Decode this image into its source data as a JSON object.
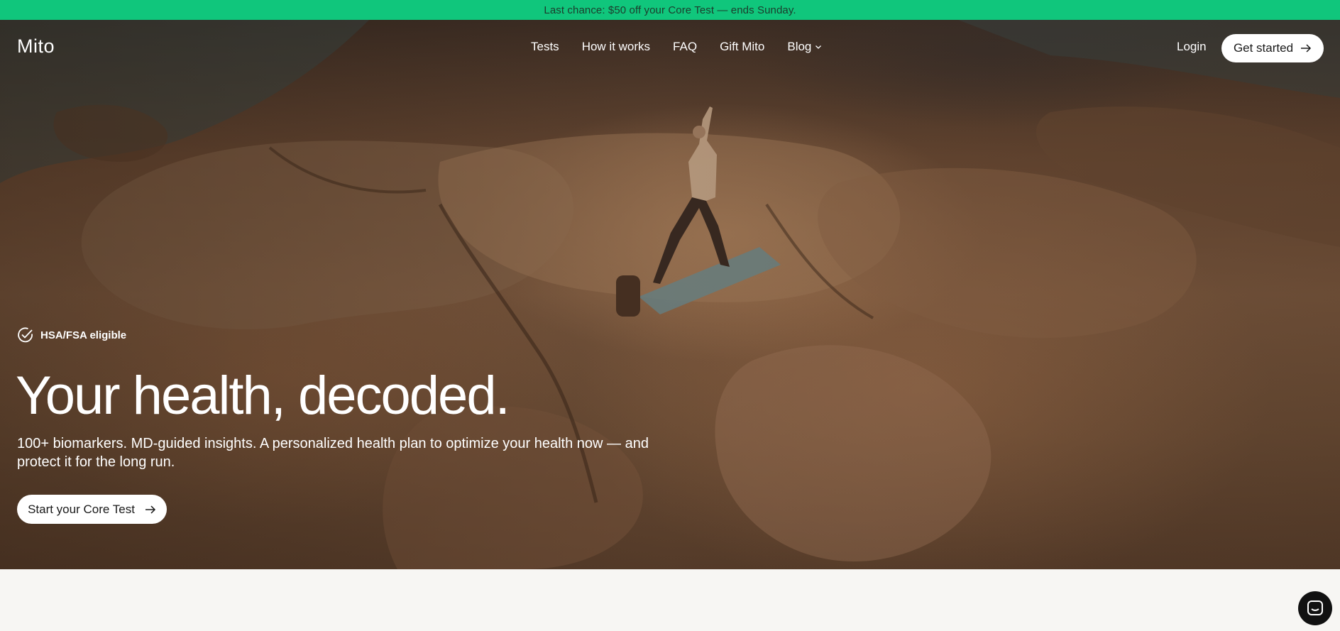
{
  "promo": {
    "text": "Last chance: $50 off your Core Test — ends Sunday."
  },
  "nav": {
    "logo": "Mito",
    "links": [
      "Tests",
      "How it works",
      "FAQ",
      "Gift Mito",
      "Blog"
    ],
    "login": "Login",
    "cta": "Get started"
  },
  "hero": {
    "badge": "HSA/FSA eligible",
    "headline": "Your health, decoded.",
    "subhead": "100+ biomarkers. MD-guided insights. A personalized health plan to optimize your health now — and protect it for the long run.",
    "cta": "Start your Core Test"
  },
  "icons": {
    "badge": "check-circle-icon",
    "blog": "chevron-down-icon",
    "cta": "arrow-right-icon",
    "chat": "chat-icon"
  },
  "colors": {
    "promo_bg": "#10c67c",
    "button_bg": "#ffffff",
    "chat_bg": "#111111"
  }
}
